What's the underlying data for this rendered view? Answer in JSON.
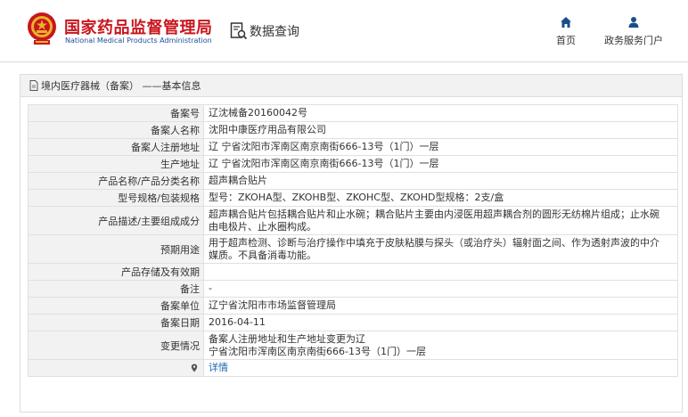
{
  "header": {
    "brand_cn": "国家药品监督管理局",
    "brand_en": "National Medical Products Administration",
    "query_label": "数据查询",
    "nav": [
      {
        "label": "首页",
        "icon": "home-icon"
      },
      {
        "label": "政务服务门户",
        "icon": "user-icon"
      }
    ]
  },
  "breadcrumb": "境内医疗器械（备案） ——基本信息",
  "rows": [
    {
      "key": "备案号",
      "value": "辽沈械备20160042号"
    },
    {
      "key": "备案人名称",
      "value": "沈阳中康医疗用品有限公司"
    },
    {
      "key": "备案人注册地址",
      "value": "辽 宁省沈阳市浑南区南京南街666-13号（1门）一层"
    },
    {
      "key": "生产地址",
      "value": "辽 宁省沈阳市浑南区南京南街666-13号（1门）一层"
    },
    {
      "key": "产品名称/产品分类名称",
      "value": "超声耦合贴片"
    },
    {
      "key": "型号规格/包装规格",
      "value": "型号：ZKOHA型、ZKOHB型、ZKOHC型、ZKOHD型规格：2支/盒"
    },
    {
      "key": "产品描述/主要组成成分",
      "value": "超声耦合贴片包括耦合贴片和止水碗；耦合贴片主要由内浸医用超声耦合剂的圆形无纺棉片组成；止水碗由电极片、止水圈构成。"
    },
    {
      "key": "预期用途",
      "value": "用于超声检测、诊断与治疗操作中填充于皮肤粘膜与探头（或治疗头）辐射面之间、作为透射声波的中介媒质。不具备消毒功能。"
    },
    {
      "key": "产品存储及有效期",
      "value": ""
    },
    {
      "key": "备注",
      "value": "-"
    },
    {
      "key": "备案单位",
      "value": "辽宁省沈阳市市场监督管理局"
    },
    {
      "key": "备案日期",
      "value": "2016-04-11"
    },
    {
      "key": "变更情况",
      "value": "备案人注册地址和生产地址变更为辽\n宁省沈阳市浑南区南京南街666-13号（1门）一层"
    },
    {
      "key": "",
      "value": "详情"
    }
  ]
}
